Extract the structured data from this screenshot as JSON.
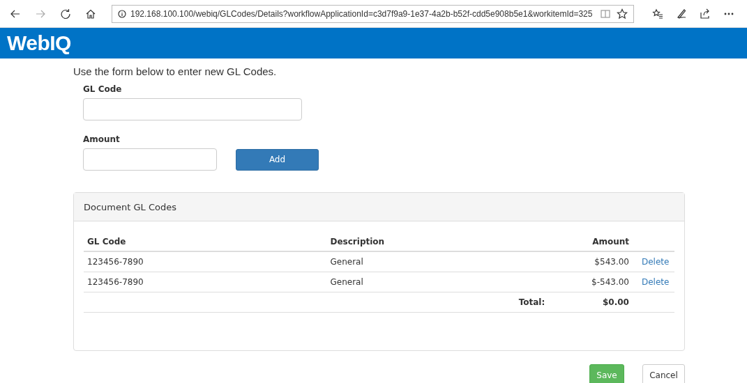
{
  "browser": {
    "url": "192.168.100.100/webiq/GLCodes/Details?workflowApplicationId=c3d7f9a9-1e37-4a2b-b52f-cdd5e908b5e1&workitemId=325"
  },
  "header": {
    "logo": "WebIQ"
  },
  "intro": "Use the form below to enter new GL Codes.",
  "form": {
    "gl_code_label": "GL Code",
    "amount_label": "Amount",
    "add_button": "Add"
  },
  "panel": {
    "title": "Document GL Codes",
    "columns": [
      "GL Code",
      "Description",
      "Amount"
    ],
    "rows": [
      {
        "gl_code": "123456-7890",
        "description": "General",
        "amount": "$543.00",
        "action": "Delete"
      },
      {
        "gl_code": "123456-7890",
        "description": "General",
        "amount": "$-543.00",
        "action": "Delete"
      }
    ],
    "total_label": "Total:",
    "total": "$0.00"
  },
  "buttons": [
    {
      "label": "Save",
      "kind": "primary"
    },
    {
      "label": "Cancel",
      "kind": "default"
    }
  ]
}
